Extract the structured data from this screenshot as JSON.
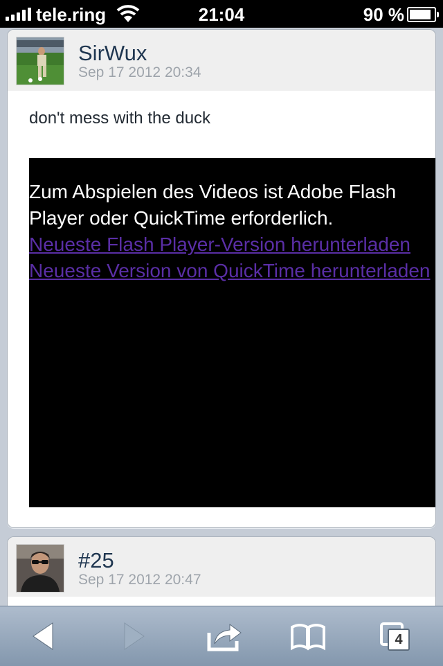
{
  "status_bar": {
    "carrier": "tele.ring",
    "time": "21:04",
    "battery": "90 %"
  },
  "posts": [
    {
      "username": "SirWux",
      "timestamp": "Sep 17 2012 20:34",
      "text": "don't mess with the duck",
      "video": {
        "message": "Zum Abspielen des Videos ist Adobe Flash Player oder QuickTime erforderlich.",
        "link_flash": "Neueste Flash Player-Version herunterladen",
        "link_quicktime": "Neueste Version von QuickTime herunterladen"
      }
    },
    {
      "username": "#25",
      "timestamp": "Sep 17 2012 20:47"
    }
  ],
  "toolbar": {
    "tabs_count": "4"
  },
  "colors": {
    "link": "#5a2ea6",
    "username": "#1f3650",
    "timestamp": "#9ea4ab",
    "page_bg": "#c5ccd6",
    "toolbar_top": "#aebccd",
    "toolbar_bottom": "#8397ad"
  }
}
